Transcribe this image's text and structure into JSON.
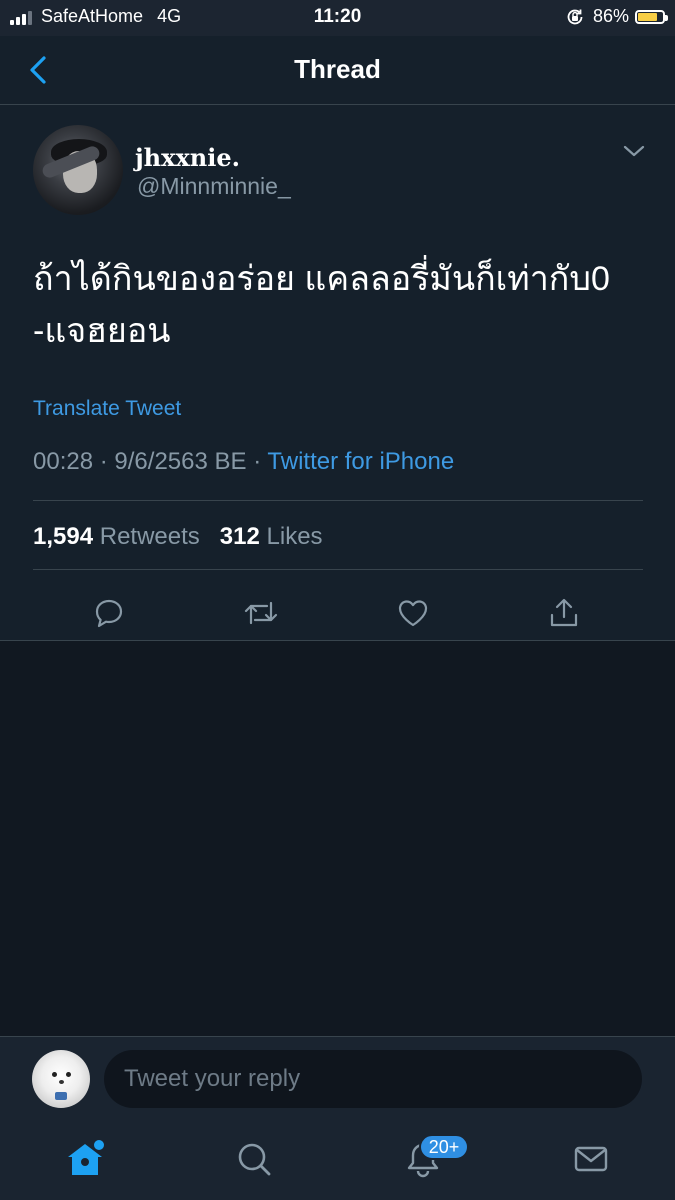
{
  "status_bar": {
    "carrier": "SafeAtHome",
    "network": "4G",
    "time": "11:20",
    "battery_percent": "86%",
    "battery_level": 0.86,
    "icons": [
      "signal-icon",
      "rotation-lock-icon",
      "battery-icon"
    ]
  },
  "header": {
    "title": "Thread",
    "back_icon": "chevron-left-icon"
  },
  "tweet": {
    "display_name": "jhxxnie.",
    "handle": "@Minnminnie_",
    "text": "ถ้าได้กินของอร่อย แคลลอรี่มันก็เท่ากับ0\n-แจฮยอน",
    "translate_label": "Translate Tweet",
    "time": "00:28",
    "date": "9/6/2563 BE",
    "separator": "·",
    "source": "Twitter for iPhone",
    "retweets_count": "1,594",
    "retweets_label": "Retweets",
    "likes_count": "312",
    "likes_label": "Likes",
    "actions": [
      "reply-icon",
      "retweet-icon",
      "like-icon",
      "share-icon"
    ]
  },
  "reply": {
    "placeholder": "Tweet your reply"
  },
  "tab_bar": {
    "items": [
      "home-icon",
      "search-icon",
      "notifications-icon",
      "messages-icon"
    ],
    "notifications_badge": "20+",
    "accent_color": "#1da1f2"
  },
  "colors": {
    "background": "#15202b",
    "secondary_text": "#8899a6",
    "link": "#3e9ae3",
    "divider": "#38444d"
  }
}
